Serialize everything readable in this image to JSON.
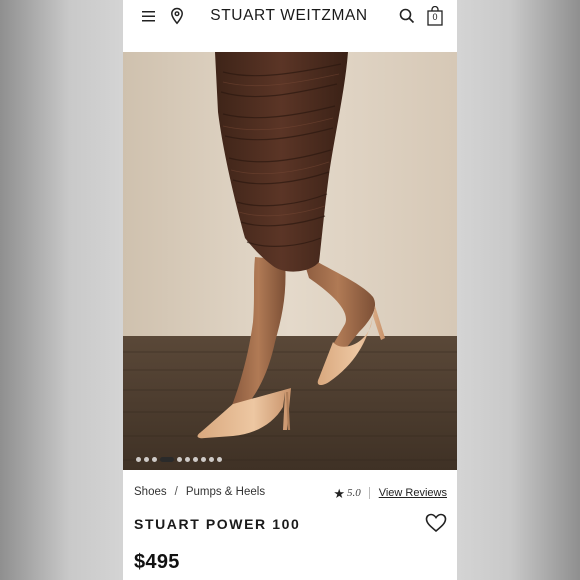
{
  "header": {
    "brand": "STUART WEITZMAN",
    "menu_icon": "hamburger-menu-icon",
    "location_icon": "map-pin-icon",
    "search_icon": "search-icon",
    "cart_icon": "shopping-bag-icon",
    "cart_count": "0"
  },
  "gallery": {
    "image_count": 10,
    "active_index": 3
  },
  "product": {
    "breadcrumb": [
      "Shoes",
      "Pumps & Heels"
    ],
    "breadcrumb_separator": "/",
    "rating": "5.0",
    "rating_icon": "star-icon",
    "reviews_link": "View Reviews",
    "name": "STUART POWER 100",
    "wishlist_icon": "heart-outline-icon",
    "price": "$495"
  }
}
